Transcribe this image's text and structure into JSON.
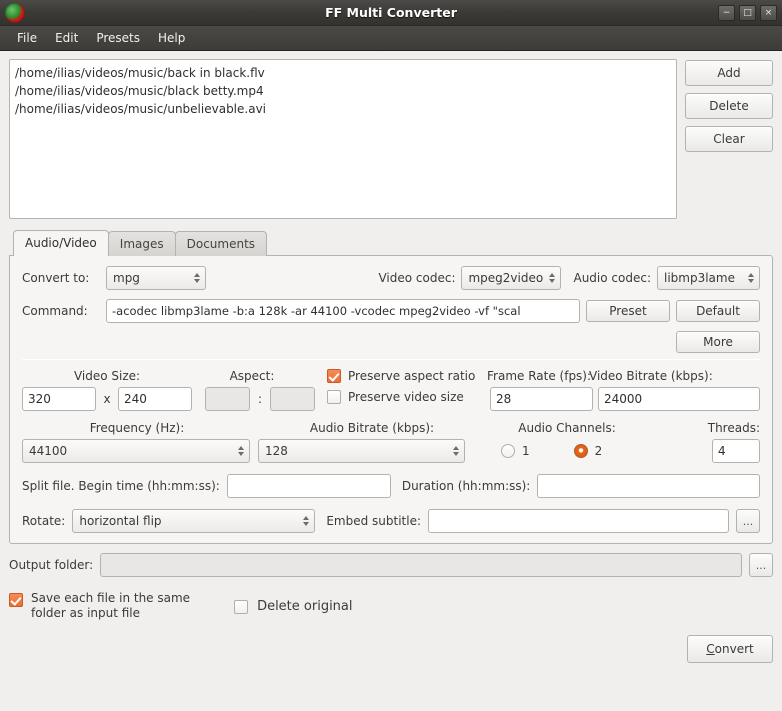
{
  "window": {
    "title": "FF Multi Converter",
    "app_icon": "ffmulticonverter-logo-icon",
    "controls": {
      "minimize": "−",
      "maximize": "□",
      "close": "×"
    }
  },
  "menubar": {
    "items": [
      "File",
      "Edit",
      "Presets",
      "Help"
    ]
  },
  "filelist": {
    "files": [
      "/home/ilias/videos/music/back in black.flv",
      "/home/ilias/videos/music/black betty.mp4",
      "/home/ilias/videos/music/unbelievable.avi"
    ]
  },
  "side_buttons": {
    "add": "Add",
    "delete": "Delete",
    "clear": "Clear"
  },
  "tabs": [
    {
      "label": "Audio/Video",
      "active": true
    },
    {
      "label": "Images",
      "active": false
    },
    {
      "label": "Documents",
      "active": false
    }
  ],
  "audio_video": {
    "convert_to_label": "Convert to:",
    "convert_to_value": "mpg",
    "video_codec_label": "Video codec:",
    "video_codec_value": "mpeg2video",
    "audio_codec_label": "Audio codec:",
    "audio_codec_value": "libmp3lame",
    "command_label": "Command:",
    "command_value": "-acodec libmp3lame -b:a 128k -ar 44100 -vcodec mpeg2video -vf \"scal",
    "preset_button": "Preset",
    "default_button": "Default",
    "more_button": "More",
    "video_size_label": "Video Size:",
    "video_size_width": "320",
    "video_size_x": "x",
    "video_size_height": "240",
    "aspect_label": "Aspect:",
    "aspect_w": "",
    "aspect_colon": ":",
    "aspect_h": "",
    "preserve_aspect_ratio_label": "Preserve aspect ratio",
    "preserve_aspect_ratio_checked": true,
    "preserve_video_size_label": "Preserve video size",
    "preserve_video_size_checked": false,
    "frame_rate_label": "Frame Rate (fps):",
    "frame_rate_value": "28",
    "video_bitrate_label": "Video Bitrate (kbps):",
    "video_bitrate_value": "24000",
    "frequency_label": "Frequency (Hz):",
    "frequency_value": "44100",
    "audio_bitrate_label": "Audio Bitrate (kbps):",
    "audio_bitrate_value": "128",
    "audio_channels_label": "Audio Channels:",
    "audio_channels_option_1": "1",
    "audio_channels_option_2": "2",
    "audio_channels_selected": "2",
    "threads_label": "Threads:",
    "threads_value": "4",
    "split_label": "Split file. Begin time (hh:mm:ss):",
    "split_value": "",
    "duration_label": "Duration (hh:mm:ss):",
    "duration_value": "",
    "rotate_label": "Rotate:",
    "rotate_value": "horizontal flip",
    "embed_subtitle_label": "Embed subtitle:",
    "embed_subtitle_value": "",
    "embed_subtitle_browse": "..."
  },
  "output": {
    "folder_label": "Output folder:",
    "folder_value": "",
    "folder_browse": "...",
    "save_same_folder_label_line1": "Save each file in the same",
    "save_same_folder_label_line2": "folder as input file",
    "save_same_folder_checked": true,
    "delete_original_label": "Delete original",
    "delete_original_checked": false
  },
  "actions": {
    "convert_mnemonic": "C",
    "convert_rest": "onvert"
  },
  "colors": {
    "accent_orange": "#ea6e34",
    "titlebar_dark": "#3b3a36",
    "panel_bg": "#f6f5f4",
    "window_bg": "#f0efee"
  }
}
